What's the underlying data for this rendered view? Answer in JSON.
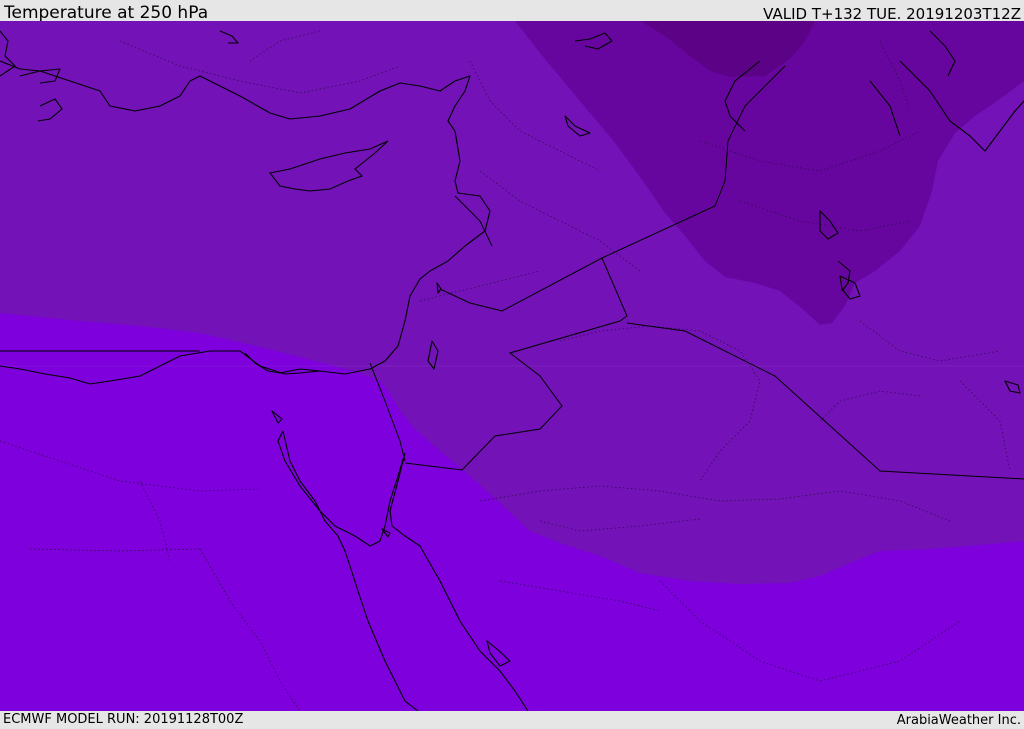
{
  "header": {
    "title": "Temperature at 250 hPa",
    "valid_time": "VALID T+132 TUE. 20191203T12Z"
  },
  "footer": {
    "model_run": "ECMWF MODEL RUN: 20191128T00Z",
    "credit": "ArabiaWeather Inc."
  },
  "map": {
    "field": "temperature-250hPa",
    "colors": {
      "band_warm": "#7d00dd",
      "band_mid": "#7212b7",
      "band_cool": "#67069f",
      "band_coldest": "#5c0286",
      "coastline": "#000000",
      "border": "#000000",
      "admin_border": "#3a1060"
    }
  }
}
